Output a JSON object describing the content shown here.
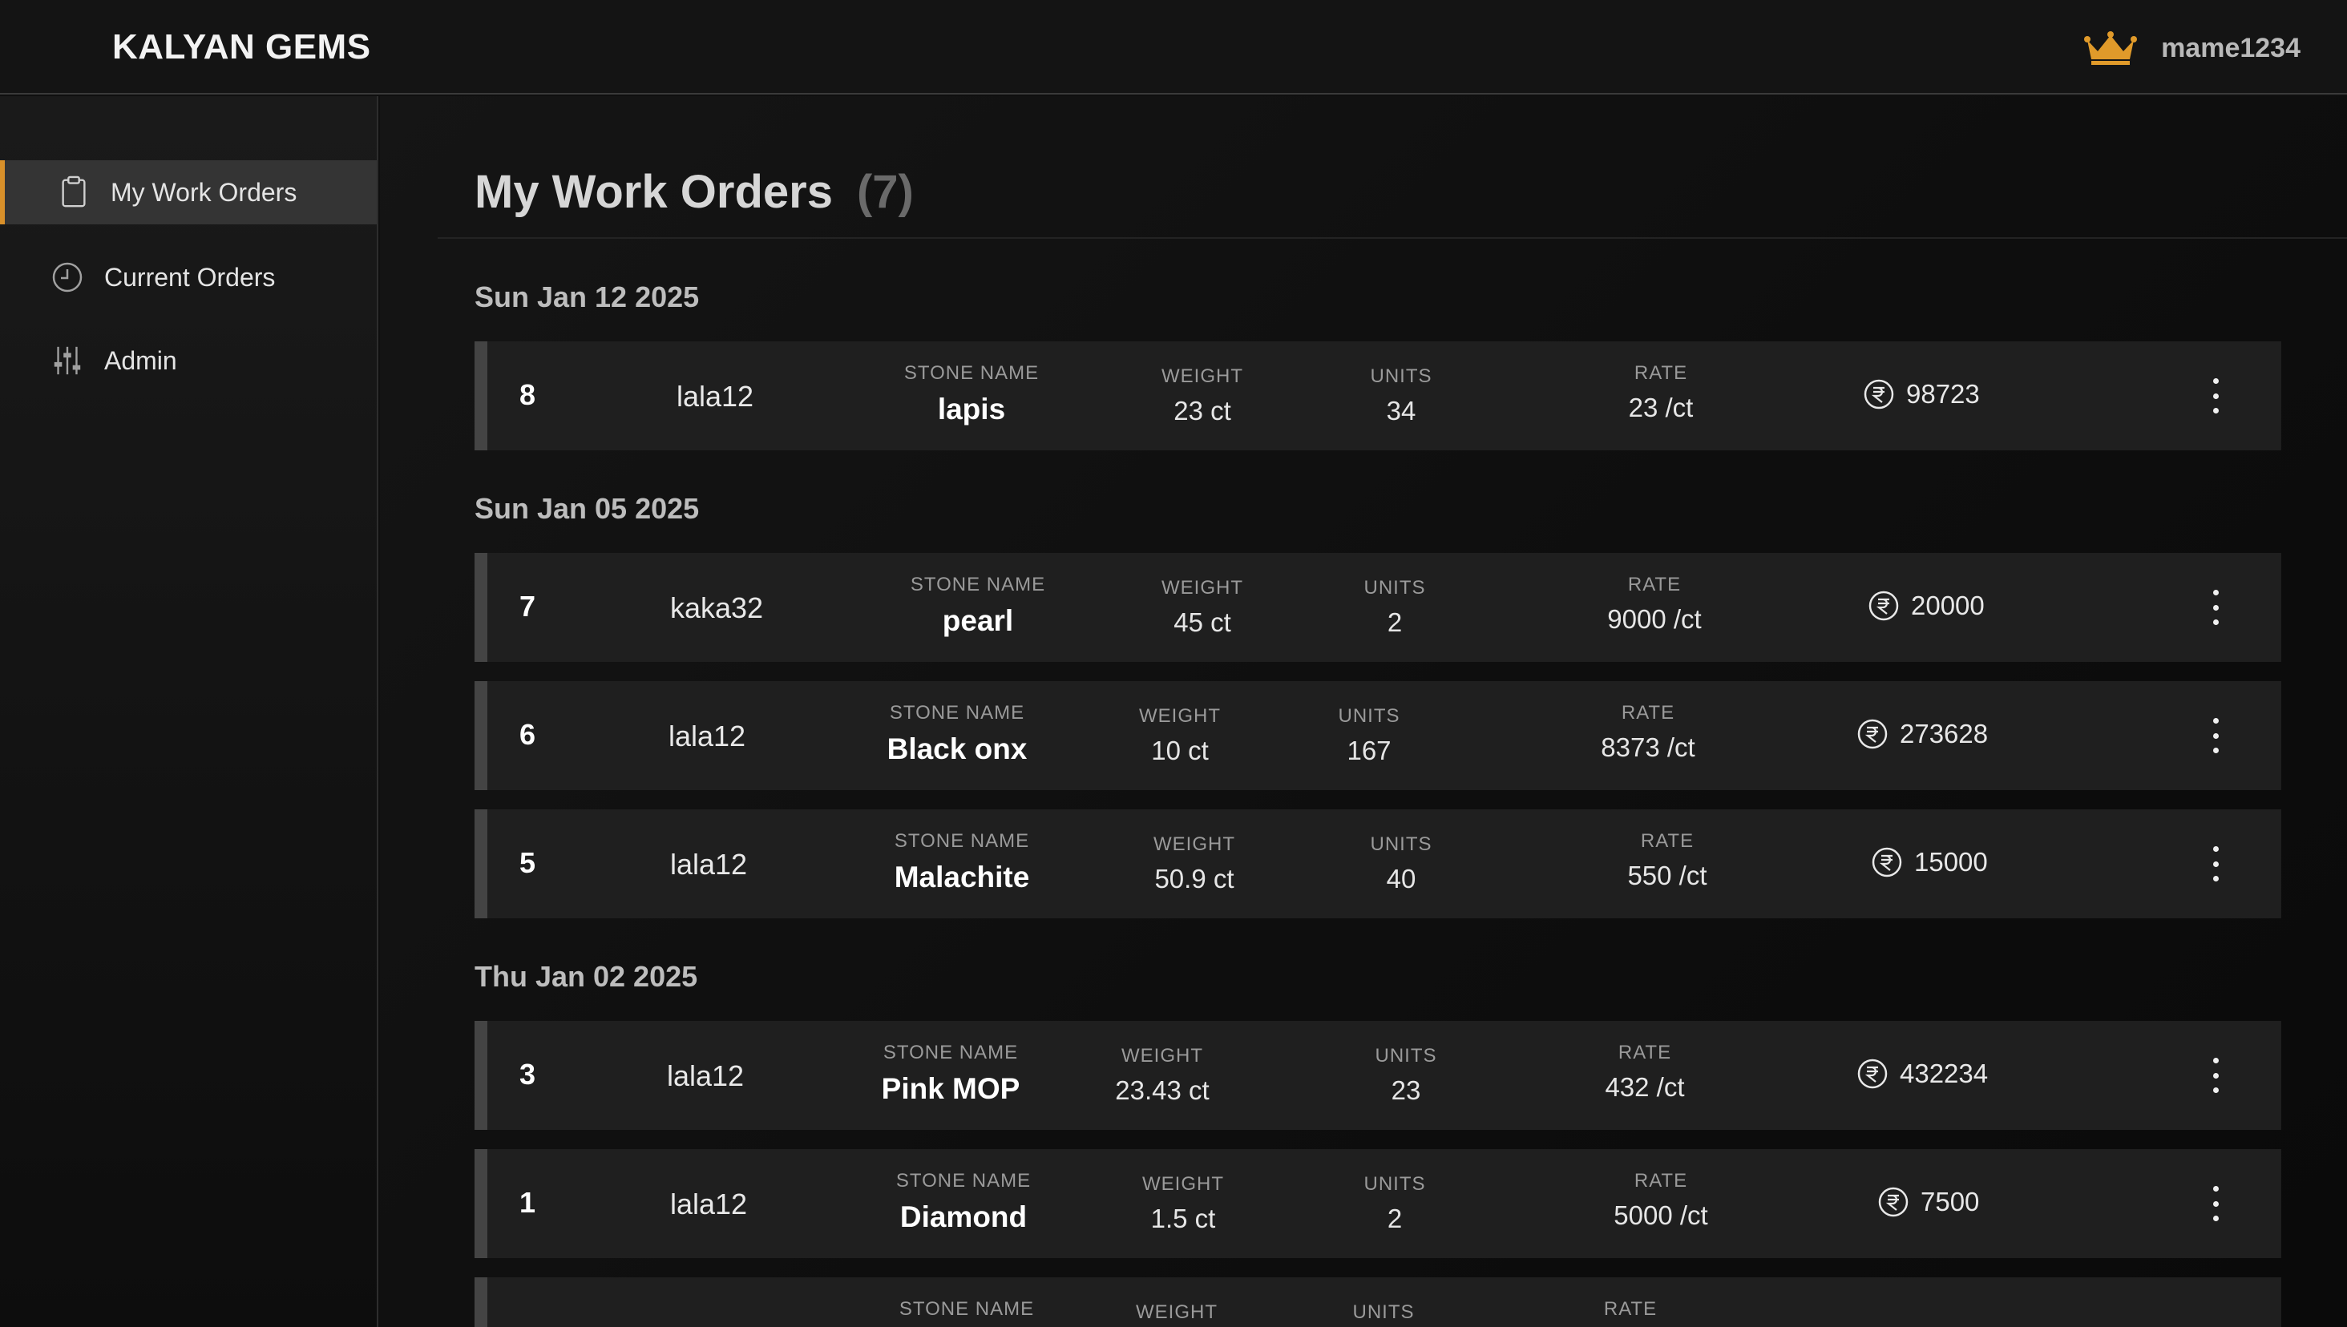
{
  "header": {
    "brand": "KALYAN GEMS",
    "username": "mame1234",
    "user_icon": "crown-icon",
    "accent_color": "#d8902a"
  },
  "sidebar": {
    "items": [
      {
        "label": "My Work Orders",
        "icon": "clipboard-icon",
        "active": true
      },
      {
        "label": "Current Orders",
        "icon": "clock-icon",
        "active": false
      },
      {
        "label": "Admin",
        "icon": "sliders-icon",
        "active": false
      }
    ]
  },
  "main": {
    "title": "My Work Orders",
    "count": "(7)",
    "labels": {
      "stone_name": "STONE NAME",
      "weight": "WEIGHT",
      "units": "UNITS",
      "rate": "RATE"
    },
    "groups": [
      {
        "date": "Sun Jan 12 2025",
        "orders": [
          {
            "id": "8",
            "customer": "lala12",
            "stone": "lapis",
            "weight": "23 ct",
            "units": "34",
            "rate": "23 /ct",
            "amount": "98723"
          }
        ]
      },
      {
        "date": "Sun Jan 05 2025",
        "orders": [
          {
            "id": "7",
            "customer": "kaka32",
            "stone": "pearl",
            "weight": "45 ct",
            "units": "2",
            "rate": "9000 /ct",
            "amount": "20000"
          },
          {
            "id": "6",
            "customer": "lala12",
            "stone": "Black onx",
            "weight": "10 ct",
            "units": "167",
            "rate": "8373 /ct",
            "amount": "273628"
          },
          {
            "id": "5",
            "customer": "lala12",
            "stone": "Malachite",
            "weight": "50.9 ct",
            "units": "40",
            "rate": "550 /ct",
            "amount": "15000"
          }
        ]
      },
      {
        "date": "Thu Jan 02 2025",
        "orders": [
          {
            "id": "3",
            "customer": "lala12",
            "stone": "Pink MOP",
            "weight": "23.43 ct",
            "units": "23",
            "rate": "432 /ct",
            "amount": "432234"
          },
          {
            "id": "1",
            "customer": "lala12",
            "stone": "Diamond",
            "weight": "1.5 ct",
            "units": "2",
            "rate": "5000 /ct",
            "amount": "7500"
          }
        ]
      }
    ]
  }
}
